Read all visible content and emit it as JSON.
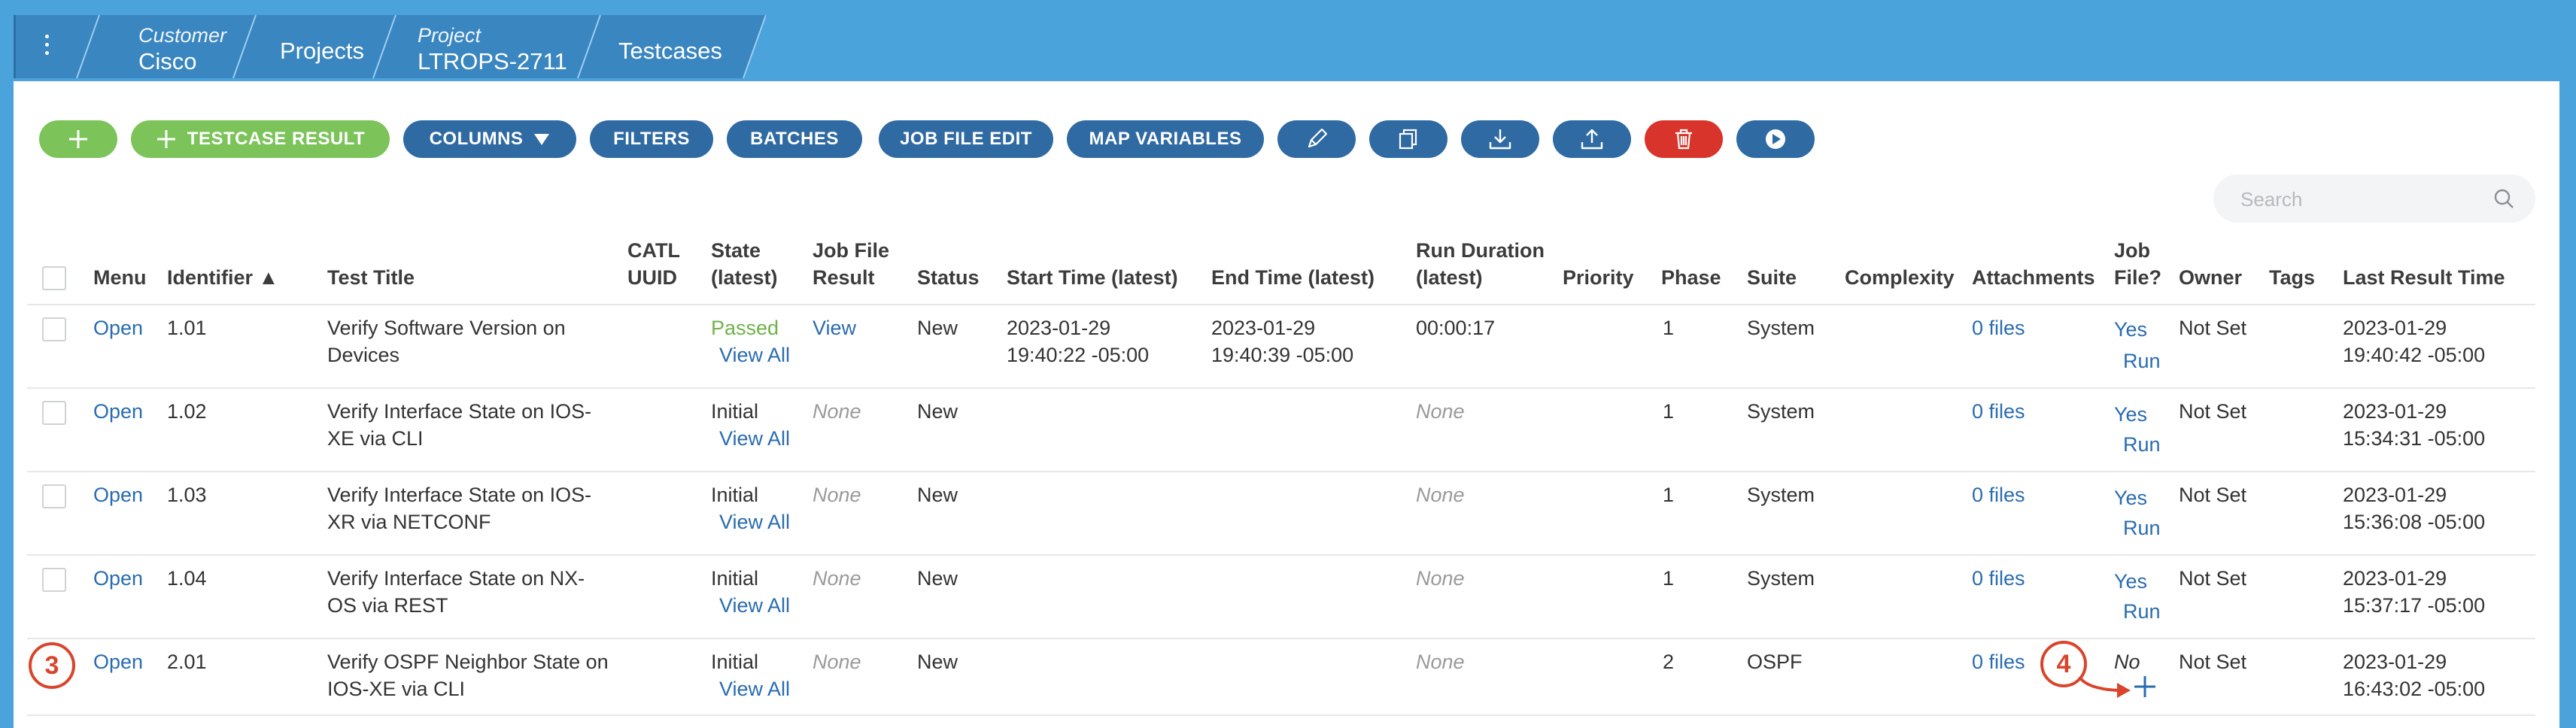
{
  "breadcrumb": {
    "customer_label": "Customer",
    "customer_name": "Cisco",
    "projects": "Projects",
    "project_label": "Project",
    "project_name": "LTROPS-2711",
    "testcases": "Testcases"
  },
  "toolbar": {
    "testcase_result": "TESTCASE RESULT",
    "columns": "COLUMNS",
    "filters": "FILTERS",
    "batches": "BATCHES",
    "job_file_edit": "JOB FILE EDIT",
    "map_variables": "MAP VARIABLES"
  },
  "search": {
    "placeholder": "Search"
  },
  "table": {
    "headers": {
      "menu": "Menu",
      "identifier": "Identifier ▲",
      "test_title": "Test Title",
      "catl_1": "CATL",
      "catl_2": "UUID",
      "state_1": "State",
      "state_2": "(latest)",
      "jobres_1": "Job File",
      "jobres_2": "Result",
      "status": "Status",
      "start": "Start Time (latest)",
      "end": "End Time (latest)",
      "dur_1": "Run Duration",
      "dur_2": "(latest)",
      "priority": "Priority",
      "phase": "Phase",
      "suite": "Suite",
      "complexity": "Complexity",
      "attachments": "Attachments",
      "jobfile_1": "Job",
      "jobfile_2": "File?",
      "owner": "Owner",
      "tags": "Tags",
      "last_result": "Last Result Time"
    },
    "rows": [
      {
        "menu": "Open",
        "id": "1.01",
        "title_1": "Verify Software Version on",
        "title_2": "Devices",
        "state": "Passed",
        "view_all": "View All",
        "job_result": "View",
        "status": "New",
        "start_1": "2023-01-29",
        "start_2": "19:40:22 -05:00",
        "end_1": "2023-01-29",
        "end_2": "19:40:39 -05:00",
        "duration": "00:00:17",
        "phase": "1",
        "suite": "System",
        "attachments": "0 files",
        "job_file": "Yes",
        "run": "Run",
        "owner": "Not Set",
        "last_1": "2023-01-29",
        "last_2": "19:40:42 -05:00"
      },
      {
        "menu": "Open",
        "id": "1.02",
        "title_1": "Verify Interface State on IOS-",
        "title_2": "XE via CLI",
        "state": "Initial",
        "view_all": "View All",
        "job_result": "None",
        "status": "New",
        "duration": "None",
        "phase": "1",
        "suite": "System",
        "attachments": "0 files",
        "job_file": "Yes",
        "run": "Run",
        "owner": "Not Set",
        "last_1": "2023-01-29",
        "last_2": "15:34:31 -05:00"
      },
      {
        "menu": "Open",
        "id": "1.03",
        "title_1": "Verify Interface State on IOS-",
        "title_2": "XR via NETCONF",
        "state": "Initial",
        "view_all": "View All",
        "job_result": "None",
        "status": "New",
        "duration": "None",
        "phase": "1",
        "suite": "System",
        "attachments": "0 files",
        "job_file": "Yes",
        "run": "Run",
        "owner": "Not Set",
        "last_1": "2023-01-29",
        "last_2": "15:36:08 -05:00"
      },
      {
        "menu": "Open",
        "id": "1.04",
        "title_1": "Verify Interface State on NX-",
        "title_2": "OS via REST",
        "state": "Initial",
        "view_all": "View All",
        "job_result": "None",
        "status": "New",
        "duration": "None",
        "phase": "1",
        "suite": "System",
        "attachments": "0 files",
        "job_file": "Yes",
        "run": "Run",
        "owner": "Not Set",
        "last_1": "2023-01-29",
        "last_2": "15:37:17 -05:00"
      },
      {
        "menu": "Open",
        "id": "2.01",
        "title_1": "Verify OSPF Neighbor State on",
        "title_2": "IOS-XE via CLI",
        "state": "Initial",
        "view_all": "View All",
        "job_result": "None",
        "status": "New",
        "duration": "None",
        "phase": "2",
        "suite": "OSPF",
        "attachments": "0 files",
        "job_file": "No",
        "owner": "Not Set",
        "last_1": "2023-01-29",
        "last_2": "16:43:02 -05:00"
      }
    ]
  },
  "annotations": {
    "left_marker": "3",
    "right_marker": "4"
  },
  "colors": {
    "header_blue": "#4aa3db",
    "button_blue": "#2f6aa3",
    "button_green": "#7cc35a",
    "button_red": "#d9342b",
    "link_blue": "#2a6cb0",
    "passed_green": "#6fb24a",
    "annotation_red": "#d9452c"
  }
}
